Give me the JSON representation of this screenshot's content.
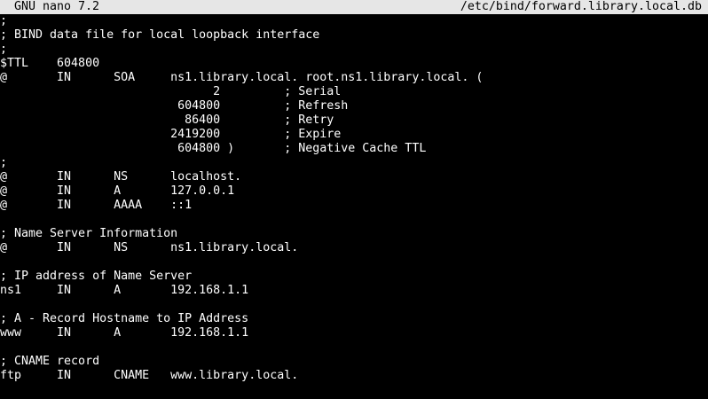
{
  "titlebar": {
    "app_name": "GNU nano 7.2",
    "file_path": "/etc/bind/forward.library.local.db"
  },
  "editor": {
    "lines": [
      ";",
      "; BIND data file for local loopback interface",
      ";",
      "$TTL    604800",
      "@       IN      SOA     ns1.library.local. root.ns1.library.local. (",
      "                              2         ; Serial",
      "                         604800         ; Refresh",
      "                          86400         ; Retry",
      "                        2419200         ; Expire",
      "                         604800 )       ; Negative Cache TTL",
      ";",
      "@       IN      NS      localhost.",
      "@       IN      A       127.0.0.1",
      "@       IN      AAAA    ::1",
      "",
      "; Name Server Information",
      "@       IN      NS      ns1.library.local.",
      "",
      "; IP address of Name Server",
      "ns1     IN      A       192.168.1.1",
      "",
      "; A - Record Hostname to IP Address",
      "www     IN      A       192.168.1.1",
      "",
      "; CNAME record",
      "ftp     IN      CNAME   www.library.local.",
      "",
      ""
    ]
  }
}
